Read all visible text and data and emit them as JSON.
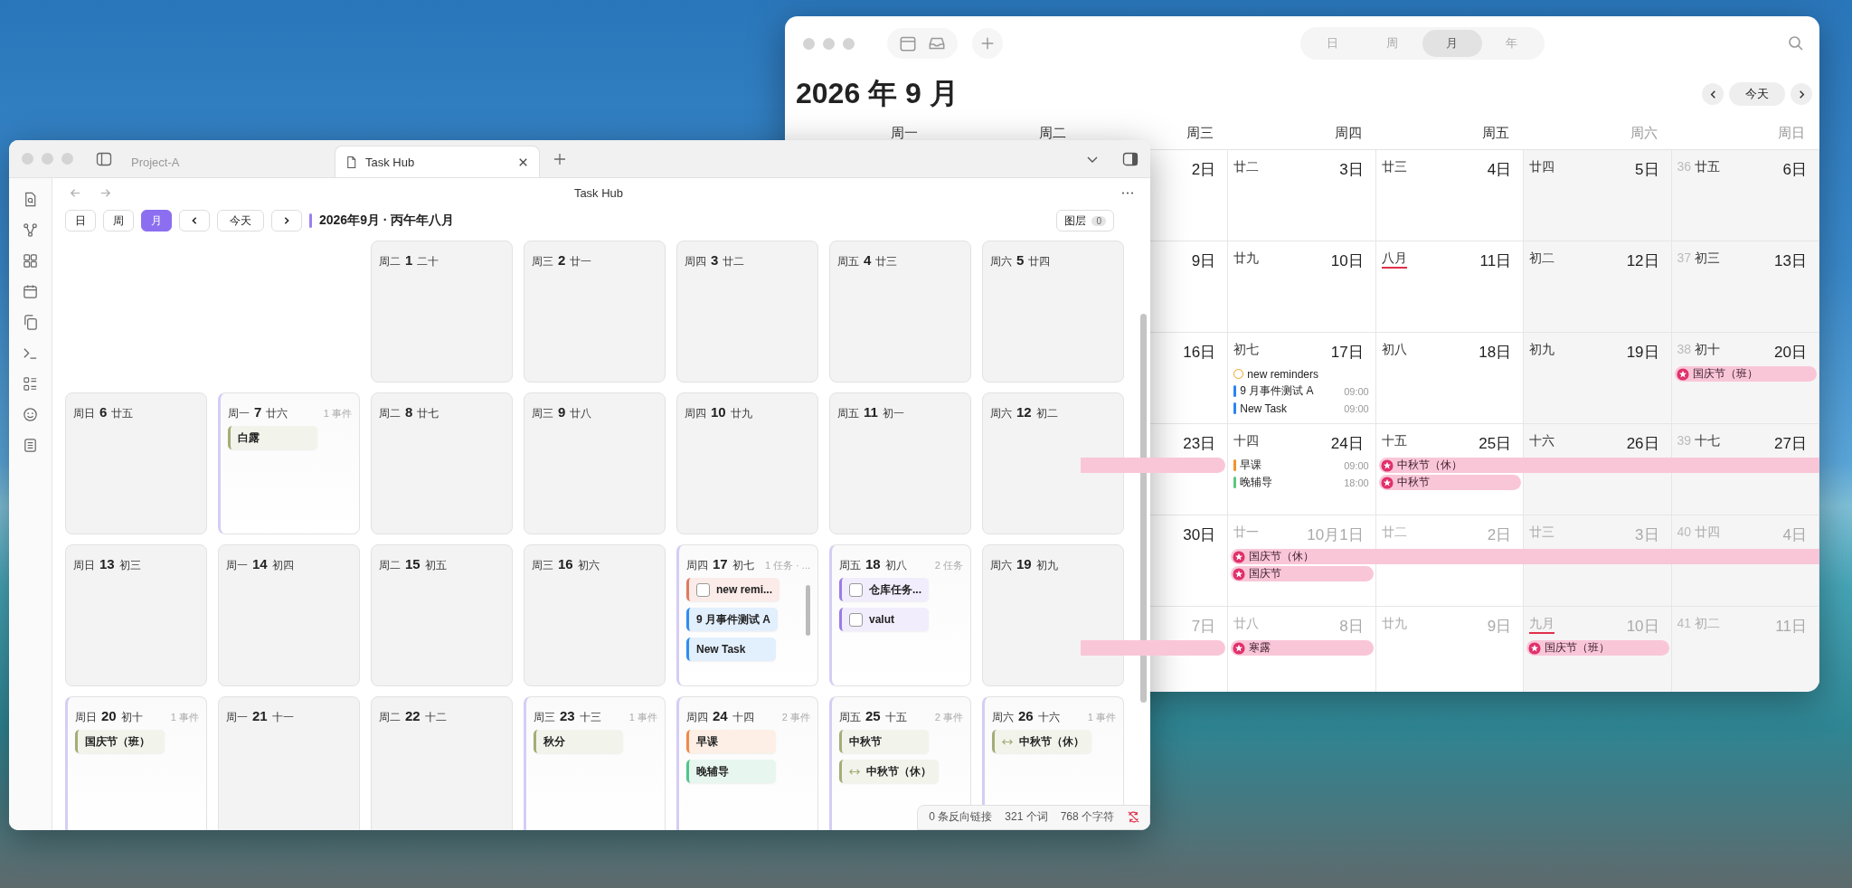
{
  "calendar_window": {
    "view_tabs": [
      {
        "label": "日",
        "selected": false
      },
      {
        "label": "周",
        "selected": false
      },
      {
        "label": "月",
        "selected": true
      },
      {
        "label": "年",
        "selected": false
      }
    ],
    "title": "2026 年 9 月",
    "today_button": "今天",
    "weekdays": [
      {
        "label": "周一",
        "weekend": false
      },
      {
        "label": "周二",
        "weekend": false
      },
      {
        "label": "周三",
        "weekend": false
      },
      {
        "label": "周四",
        "weekend": false
      },
      {
        "label": "周五",
        "weekend": false
      },
      {
        "label": "周六",
        "weekend": true
      },
      {
        "label": "周日",
        "weekend": true
      }
    ],
    "weeks": [
      {
        "cells": [
          {
            "day": "2日",
            "dimmed": false
          },
          {
            "lunar": "廿二",
            "day": "3日",
            "dimmed": false
          },
          {
            "lunar": "廿三",
            "day": "4日",
            "dimmed": false
          },
          {
            "lunar": "廿四",
            "day": "5日",
            "dimmed": false
          },
          {
            "week_number": "36",
            "lunar": "廿五",
            "day": "6日",
            "dimmed": false
          }
        ]
      },
      {
        "cells": [
          {
            "day": "9日",
            "dimmed": false
          },
          {
            "lunar": "廿九",
            "day": "10日",
            "dimmed": false
          },
          {
            "lunar": "八月",
            "month_start": true,
            "day": "11日",
            "dimmed": false
          },
          {
            "lunar": "初二",
            "day": "12日",
            "dimmed": false
          },
          {
            "week_number": "37",
            "lunar": "初三",
            "day": "13日",
            "dimmed": false
          }
        ]
      },
      {
        "cells": [
          {
            "day": "16日",
            "dimmed": false
          },
          {
            "lunar": "初七",
            "day": "17日",
            "dimmed": false,
            "items": [
              {
                "kind": "reminder",
                "title": "new reminders"
              },
              {
                "kind": "timed",
                "title": "9 月事件测试 A",
                "time": "09:00",
                "color": "#2a84f0"
              },
              {
                "kind": "timed",
                "title": "New Task",
                "time": "09:00",
                "color": "#2a84f0"
              }
            ]
          },
          {
            "lunar": "初八",
            "day": "18日",
            "dimmed": false
          },
          {
            "lunar": "初九",
            "day": "19日",
            "dimmed": false
          },
          {
            "week_number": "38",
            "lunar": "初十",
            "day": "20日",
            "dimmed": false,
            "items": [
              {
                "kind": "holiday",
                "title": "国庆节（班）",
                "to_week_end": false
              }
            ]
          }
        ]
      },
      {
        "cells": [
          {
            "day": "23日",
            "dimmed": false,
            "items": [
              {
                "kind": "tail"
              }
            ]
          },
          {
            "lunar": "十四",
            "day": "24日",
            "dimmed": false,
            "items": [
              {
                "kind": "timed",
                "title": "早课",
                "time": "09:00",
                "color": "#f0952b"
              },
              {
                "kind": "timed",
                "title": "晚辅导",
                "time": "18:00",
                "color": "#5cc77f"
              }
            ]
          },
          {
            "lunar": "十五",
            "day": "25日",
            "dimmed": false,
            "items": [
              {
                "kind": "holiday",
                "title": "中秋节（休）",
                "to_week_end": true
              },
              {
                "kind": "holiday",
                "title": "中秋节",
                "to_week_end": false
              }
            ]
          },
          {
            "lunar": "十六",
            "day": "26日",
            "dimmed": false
          },
          {
            "week_number": "39",
            "lunar": "十七",
            "day": "27日",
            "dimmed": false
          }
        ]
      },
      {
        "cells": [
          {
            "day": "30日",
            "dimmed": false
          },
          {
            "lunar": "廿一",
            "day": "10月1日",
            "dimmed": true,
            "items": [
              {
                "kind": "holiday",
                "title": "国庆节（休）",
                "to_week_end": true
              },
              {
                "kind": "holiday",
                "title": "国庆节",
                "to_week_end": false
              }
            ]
          },
          {
            "lunar": "廿二",
            "day": "2日",
            "dimmed": true
          },
          {
            "lunar": "廿三",
            "day": "3日",
            "dimmed": true
          },
          {
            "week_number": "40",
            "lunar": "廿四",
            "day": "4日",
            "dimmed": true
          }
        ]
      },
      {
        "cells": [
          {
            "day": "7日",
            "dimmed": true,
            "items": [
              {
                "kind": "tail"
              }
            ]
          },
          {
            "lunar": "廿八",
            "day": "8日",
            "dimmed": true,
            "items": [
              {
                "kind": "holiday",
                "title": "寒露",
                "to_week_end": false
              }
            ]
          },
          {
            "lunar": "廿九",
            "day": "9日",
            "dimmed": true
          },
          {
            "lunar": "九月",
            "month_start": true,
            "day": "10日",
            "dimmed": true,
            "items": [
              {
                "kind": "holiday",
                "title": "国庆节（班）",
                "to_week_end": false
              }
            ]
          },
          {
            "week_number": "41",
            "lunar": "初二",
            "day": "11日",
            "dimmed": true
          }
        ]
      }
    ]
  },
  "editor_window": {
    "tabs": [
      {
        "label": "Project-A",
        "selected": false
      },
      {
        "label": "Task Hub",
        "selected": true
      }
    ],
    "view_title": "Task Hub",
    "toolbar": {
      "views": [
        {
          "label": "日",
          "selected": false
        },
        {
          "label": "周",
          "selected": false
        },
        {
          "label": "月",
          "selected": true
        }
      ],
      "today_button": "今天",
      "period": "2026年9月 · 丙午年八月",
      "layers_label": "图层",
      "layers_count": "0"
    },
    "weeks": [
      {
        "cells": [
          {
            "weekday": "周二",
            "day": "1",
            "lunar": "二十"
          },
          {
            "weekday": "周三",
            "day": "2",
            "lunar": "廿一"
          },
          {
            "weekday": "周四",
            "day": "3",
            "lunar": "廿二"
          },
          {
            "weekday": "周五",
            "day": "4",
            "lunar": "廿三"
          },
          {
            "weekday": "周六",
            "day": "5",
            "lunar": "廿四"
          }
        ]
      },
      {
        "cells": [
          {
            "weekday": "周日",
            "day": "6",
            "lunar": "廿五"
          },
          {
            "weekday": "周一",
            "day": "7",
            "lunar": "廿六",
            "count": "1 事件",
            "items": [
              {
                "kind": "event",
                "title": "白露",
                "color": "#a3ad78"
              }
            ]
          },
          {
            "weekday": "周二",
            "day": "8",
            "lunar": "廿七"
          },
          {
            "weekday": "周三",
            "day": "9",
            "lunar": "廿八"
          },
          {
            "weekday": "周四",
            "day": "10",
            "lunar": "廿九"
          },
          {
            "weekday": "周五",
            "day": "11",
            "lunar": "初一"
          },
          {
            "weekday": "周六",
            "day": "12",
            "lunar": "初二"
          }
        ]
      },
      {
        "cells": [
          {
            "weekday": "周日",
            "day": "13",
            "lunar": "初三"
          },
          {
            "weekday": "周一",
            "day": "14",
            "lunar": "初四"
          },
          {
            "weekday": "周二",
            "day": "15",
            "lunar": "初五"
          },
          {
            "weekday": "周三",
            "day": "16",
            "lunar": "初六"
          },
          {
            "weekday": "周四",
            "day": "17",
            "lunar": "初七",
            "count": "1 任务 · ...",
            "items": [
              {
                "kind": "task",
                "title": "new remi...",
                "color": "#e07a62",
                "checked": false
              },
              {
                "kind": "event",
                "title": "9 月事件测试 A",
                "color": "#2f8cf0"
              },
              {
                "kind": "event",
                "title": "New Task",
                "color": "#2f8cf0"
              }
            ]
          },
          {
            "weekday": "周五",
            "day": "18",
            "lunar": "初八",
            "count": "2 任务",
            "items": [
              {
                "kind": "task",
                "title": "仓库任务...",
                "color": "#9a7be6",
                "checked": false
              },
              {
                "kind": "task",
                "title": "valut",
                "color": "#9a7be6",
                "checked": false
              }
            ]
          },
          {
            "weekday": "周六",
            "day": "19",
            "lunar": "初九"
          }
        ]
      },
      {
        "cells": [
          {
            "weekday": "周日",
            "day": "20",
            "lunar": "初十",
            "count": "1 事件",
            "items": [
              {
                "kind": "event",
                "title": "国庆节（班）",
                "color": "#a3ad78"
              }
            ]
          },
          {
            "weekday": "周一",
            "day": "21",
            "lunar": "十一"
          },
          {
            "weekday": "周二",
            "day": "22",
            "lunar": "十二"
          },
          {
            "weekday": "周三",
            "day": "23",
            "lunar": "十三",
            "count": "1 事件",
            "items": [
              {
                "kind": "event",
                "title": "秋分",
                "color": "#a3ad78"
              }
            ]
          },
          {
            "weekday": "周四",
            "day": "24",
            "lunar": "十四",
            "count": "2 事件",
            "items": [
              {
                "kind": "event",
                "title": "早课",
                "color": "#f08a4b"
              },
              {
                "kind": "event",
                "title": "晚辅导",
                "color": "#52c48a"
              }
            ]
          },
          {
            "weekday": "周五",
            "day": "25",
            "lunar": "十五",
            "count": "2 事件",
            "items": [
              {
                "kind": "event",
                "title": "中秋节",
                "color": "#a3ad78"
              },
              {
                "kind": "event",
                "title": "中秋节（休）",
                "color": "#a3ad78",
                "multi_day": true
              }
            ]
          },
          {
            "weekday": "周六",
            "day": "26",
            "lunar": "十六",
            "count": "1 事件",
            "items": [
              {
                "kind": "event",
                "title": "中秋节（休）",
                "color": "#a3ad78",
                "multi_day": true
              }
            ]
          }
        ]
      }
    ],
    "status_bar": [
      "0 条反向链接",
      "321 个词",
      "768 个字符"
    ]
  }
}
